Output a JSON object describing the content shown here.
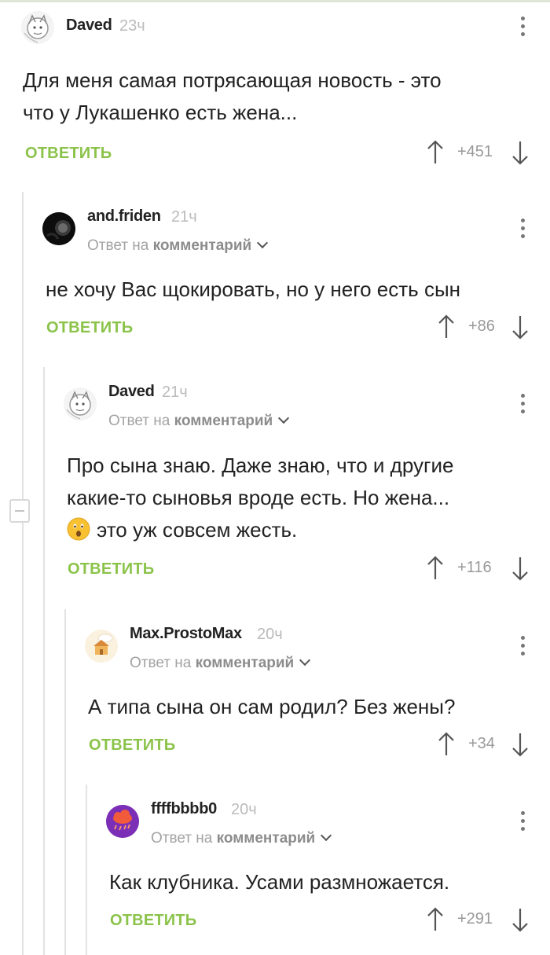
{
  "comments": [
    {
      "author": "Daved",
      "time": "23ч",
      "text_lines": [
        "Для меня самая потрясающая новость - это",
        "что у Лукашенко есть жена..."
      ],
      "reply_label": "ОТВЕТИТЬ",
      "score": "+451",
      "avatar_icon": "cat-sketch-avatar"
    },
    {
      "author": "and.friden",
      "time": "21ч",
      "reply_to_prefix": "Ответ на",
      "reply_to_target": "комментарий",
      "text_lines": [
        "не хочу Вас щокировать, но у него есть сын"
      ],
      "reply_label": "ОТВЕТИТЬ",
      "score": "+86",
      "avatar_icon": "dark-avatar"
    },
    {
      "author": "Daved",
      "time": "21ч",
      "reply_to_prefix": "Ответ на",
      "reply_to_target": "комментарий",
      "text_lines": [
        "Про сына знаю. Даже знаю, что и другие",
        "какие-то сыновья вроде есть. Но жена...",
        "это уж совсем жесть."
      ],
      "emoji": "astonished-face",
      "reply_label": "ОТВЕТИТЬ",
      "score": "+116",
      "avatar_icon": "cat-sketch-avatar"
    },
    {
      "author": "Max.ProstoMax",
      "time": "20ч",
      "reply_to_prefix": "Ответ на",
      "reply_to_target": "комментарий",
      "text_lines": [
        "А типа сына он сам родил? Без жены?"
      ],
      "reply_label": "ОТВЕТИТЬ",
      "score": "+34",
      "avatar_icon": "house-avatar"
    },
    {
      "author": "ffffbbbb0",
      "time": "20ч",
      "reply_to_prefix": "Ответ на",
      "reply_to_target": "комментарий",
      "text_lines": [
        "Как клубника. Усами размножается."
      ],
      "reply_label": "ОТВЕТИТЬ",
      "score": "+291",
      "avatar_icon": "rain-cloud-avatar"
    }
  ],
  "colors": {
    "accent_green": "#8bc34a",
    "muted_gray": "#bbbbbb",
    "thread_line": "#e3e3e3"
  }
}
